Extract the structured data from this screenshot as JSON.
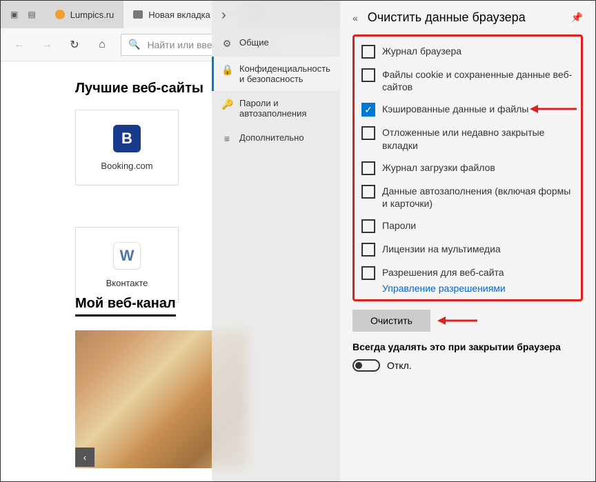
{
  "tabs": {
    "t1": "Lumpics.ru",
    "t2": "Новая вкладка"
  },
  "address": {
    "placeholder": "Найти или ввести веб-адрес"
  },
  "page": {
    "heading": "Лучшие веб-сайты",
    "tile1": "Booking.com",
    "tile2": "Вконтакте",
    "feed": "Мой веб-канал"
  },
  "settings_menu": {
    "general": "Общие",
    "privacy": "Конфиденциальность и безопасность",
    "passwords": "Пароли и автозаполнения",
    "advanced": "Дополнительно"
  },
  "panel": {
    "title": "Очистить данные браузера",
    "items": {
      "history": "Журнал браузера",
      "cookies": "Файлы cookie и сохраненные данные веб-сайтов",
      "cache": "Кэшированные данные и файлы",
      "tabs": "Отложенные или недавно закрытые вкладки",
      "downloads": "Журнал загрузки файлов",
      "autofill": "Данные автозаполнения (включая формы и карточки)",
      "passwords": "Пароли",
      "media": "Лицензии на мультимедиа",
      "perms": "Разрешения для веб-сайта"
    },
    "manage_link": "Управление разрешениями",
    "clear_btn": "Очистить",
    "always": "Всегда удалять это при закрытии браузера",
    "toggle_off": "Откл."
  },
  "checked": {
    "cache": true
  }
}
